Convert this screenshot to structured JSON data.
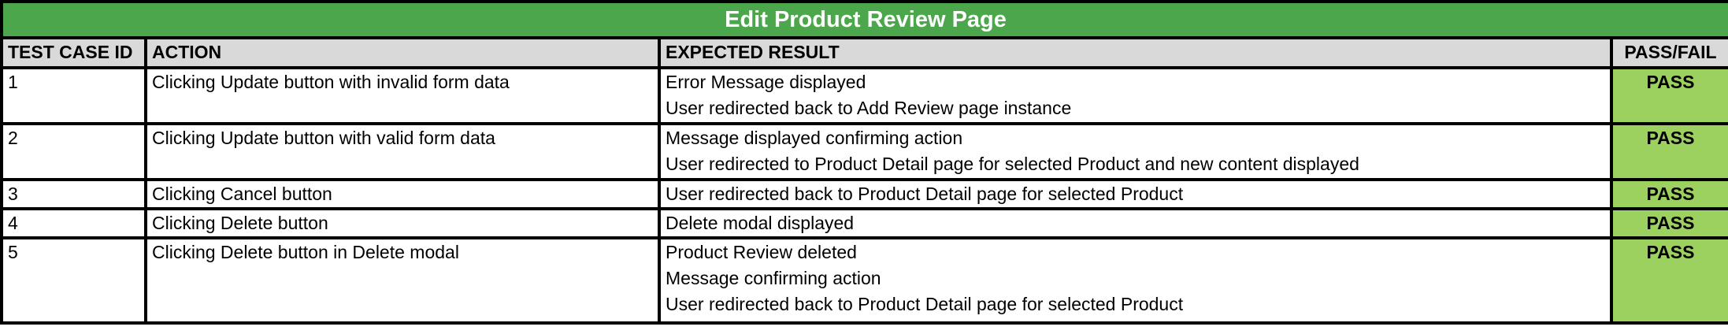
{
  "title": "Edit Product Review Page",
  "headers": {
    "id": "TEST CASE ID",
    "action": "ACTION",
    "expected": "EXPECTED RESULT",
    "result": "PASS/FAIL"
  },
  "rows": [
    {
      "id": "1",
      "action": "Clicking Update button with invalid form data",
      "expected": [
        "Error Message displayed",
        "User redirected back to Add Review page instance"
      ],
      "result": "PASS"
    },
    {
      "id": "2",
      "action": "Clicking Update button with valid form data",
      "expected": [
        "Message displayed confirming action",
        "User redirected to Product Detail page for selected Product and new content displayed"
      ],
      "result": "PASS"
    },
    {
      "id": "3",
      "action": "Clicking Cancel button",
      "expected": [
        "User redirected back to Product Detail page for selected Product"
      ],
      "result": "PASS"
    },
    {
      "id": "4",
      "action": "Clicking Delete button",
      "expected": [
        "Delete modal displayed"
      ],
      "result": "PASS"
    },
    {
      "id": "5",
      "action": "Clicking Delete button in Delete modal",
      "expected": [
        "Product Review deleted",
        "Message confirming action",
        "User redirected back to Product Detail page for selected Product"
      ],
      "result": "PASS"
    }
  ],
  "colors": {
    "title_bg": "#4ca64c",
    "header_bg": "#d9d9d9",
    "pass_bg": "#9cd160"
  }
}
